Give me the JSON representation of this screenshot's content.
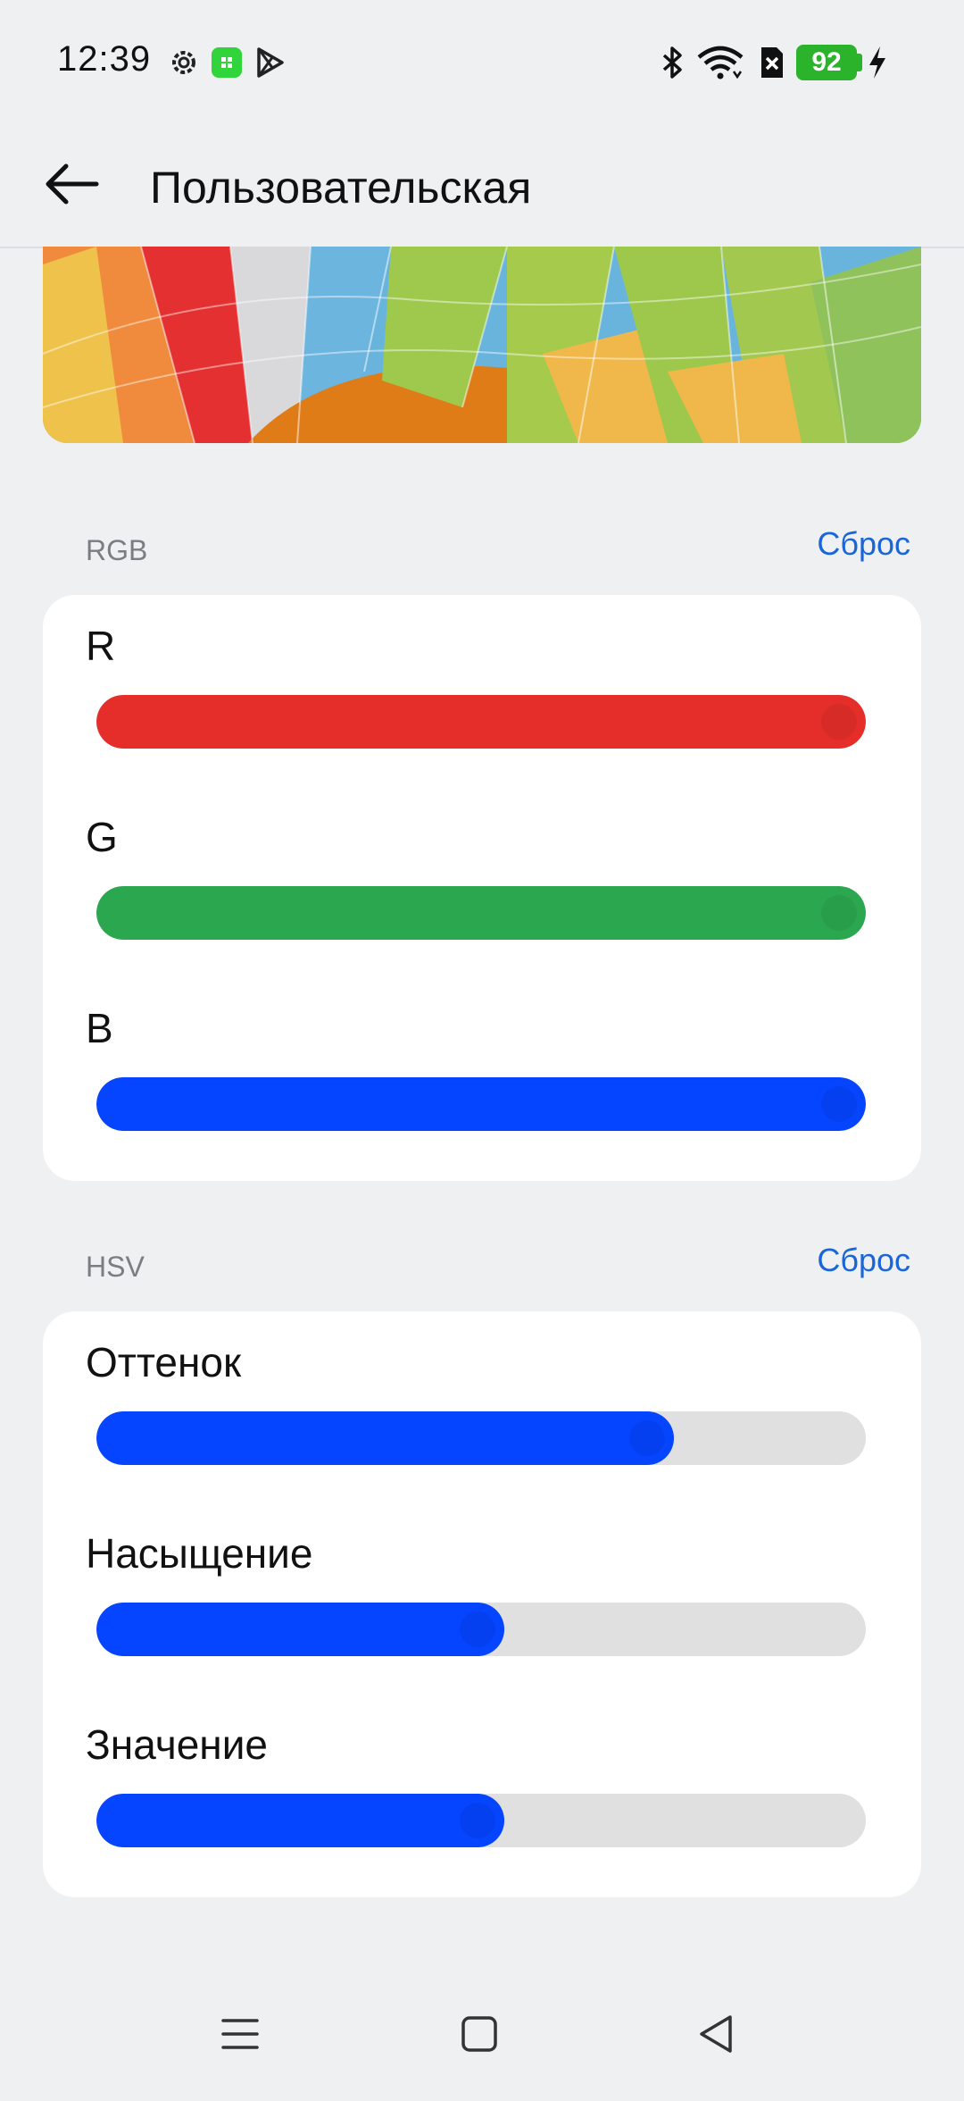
{
  "status_bar": {
    "time": "12:39",
    "battery_level": "92",
    "icons": [
      "settings-icon",
      "app-icon",
      "play-store-icon",
      "bluetooth-icon",
      "wifi-icon",
      "sim-off-icon",
      "battery-icon",
      "charging-icon"
    ]
  },
  "header": {
    "title": "Пользовательская",
    "back_icon": "arrow-left-icon"
  },
  "rgb": {
    "label": "RGB",
    "reset": "Сброс",
    "sliders": [
      {
        "label": "R",
        "value": 1.0,
        "color": "#e52e2a"
      },
      {
        "label": "G",
        "value": 1.0,
        "color": "#2ba84f"
      },
      {
        "label": "B",
        "value": 1.0,
        "color": "#0545ff"
      }
    ]
  },
  "hsv": {
    "label": "HSV",
    "reset": "Сброс",
    "sliders": [
      {
        "label": "Оттенок",
        "value": 0.75,
        "color": "#0545ff"
      },
      {
        "label": "Насыщение",
        "value": 0.53,
        "color": "#0545ff"
      },
      {
        "label": "Значение",
        "value": 0.53,
        "color": "#0545ff"
      }
    ]
  },
  "colors": {
    "accent": "#1a66d9",
    "background": "#eef0f2",
    "track": "#e0e0e0"
  },
  "navbar": {
    "icons": [
      "menu-icon",
      "home-icon",
      "back-triangle-icon"
    ]
  }
}
